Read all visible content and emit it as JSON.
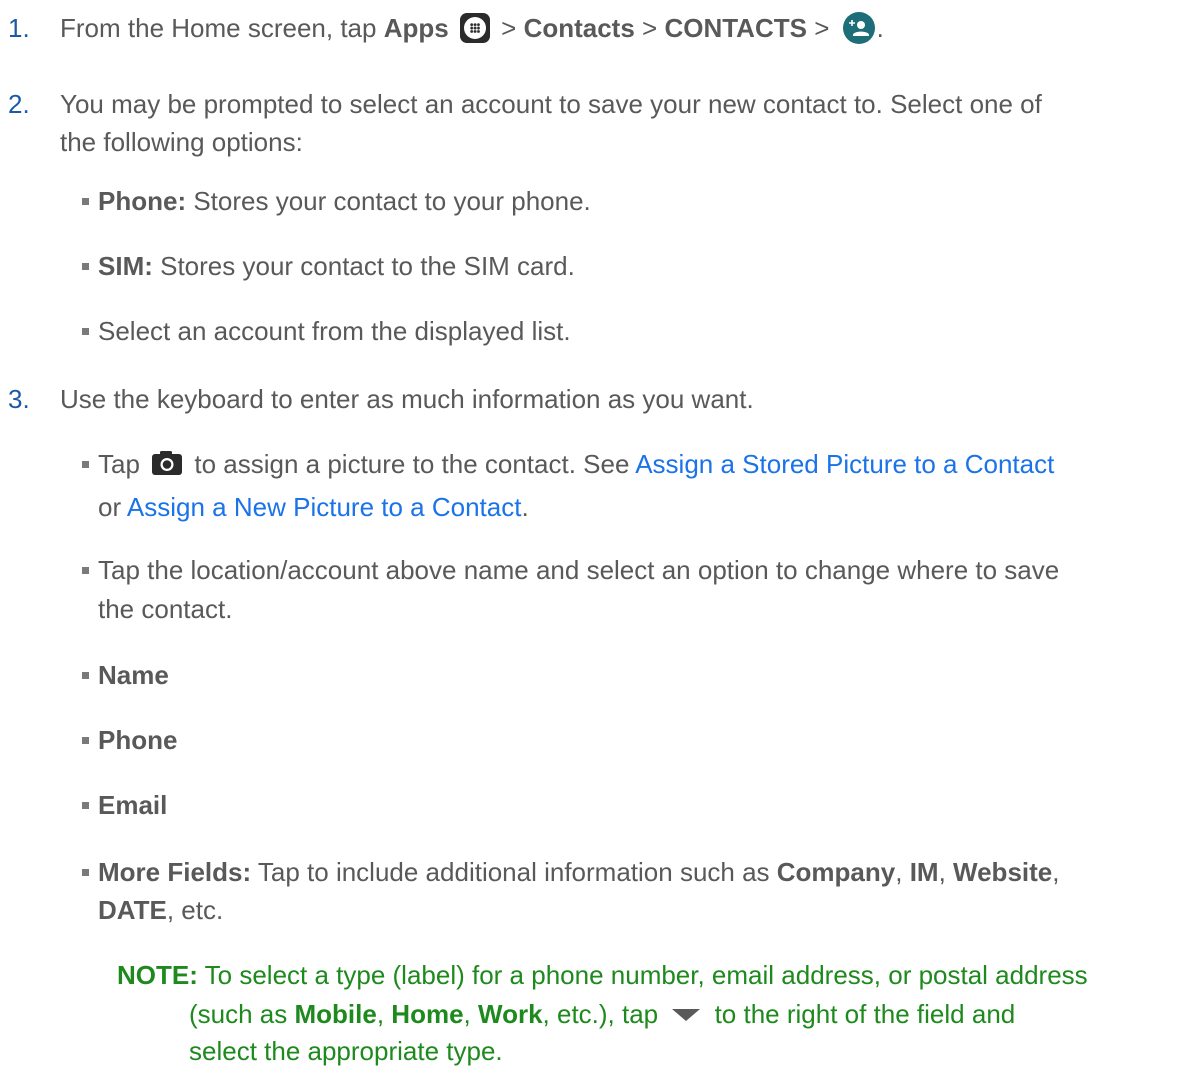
{
  "step1": {
    "number": "1.",
    "text_a": "From the Home screen, tap ",
    "apps": "Apps",
    "sep1": " > ",
    "contacts": "Contacts",
    "sep2": " > ",
    "contacts_tab": "CONTACTS",
    "sep3": " > ",
    "end": "."
  },
  "step2": {
    "number": "2.",
    "line1": "You may be prompted to select an account to save your new contact to. Select one of",
    "line2": "the following options:",
    "options": [
      {
        "label": "Phone:",
        "text": " Stores your contact to your phone."
      },
      {
        "label": "SIM:",
        "text": " Stores your contact to the SIM card."
      },
      {
        "label": "",
        "text": "Select an account from the displayed list."
      }
    ]
  },
  "step3": {
    "number": "3.",
    "text": "Use the keyboard to enter as much information as you want.",
    "picture": {
      "tap": "Tap ",
      "after": " to assign a picture to the contact. See ",
      "link1": "Assign a Stored Picture to a Contact",
      "or": "or ",
      "link2": "Assign a New Picture to a Contact",
      "end": "."
    },
    "location": {
      "line1": "Tap the location/account above name and select an option to change where to save",
      "line2": "the contact."
    },
    "fields": [
      "Name",
      "Phone",
      "Email"
    ],
    "more": {
      "label": "More Fields:",
      "text": " Tap to include additional information such as ",
      "company": "Company",
      "comma1": ", ",
      "im": "IM",
      "comma2": ", ",
      "website": "Website",
      "comma3": ",",
      "date": "DATE",
      "etc": ", etc."
    }
  },
  "note": {
    "label": "NOTE:",
    "line1": " To select a type (label) for a phone number, email address, or postal address",
    "line2a": "(such as ",
    "mobile": "Mobile",
    "c1": ", ",
    "home": "Home",
    "c2": ", ",
    "work": "Work",
    "line2b": ", etc.), tap ",
    "line2c": " to the right of the field and",
    "line3": "select the appropriate type."
  },
  "icons": {
    "apps": "apps-grid-icon",
    "add_contact": "add-contact-icon",
    "camera": "camera-icon",
    "dropdown": "dropdown-arrow-icon"
  },
  "colors": {
    "text": "#595959",
    "link": "#1a73e8",
    "note": "#1e8a1e",
    "number": "#1c5aa8"
  }
}
